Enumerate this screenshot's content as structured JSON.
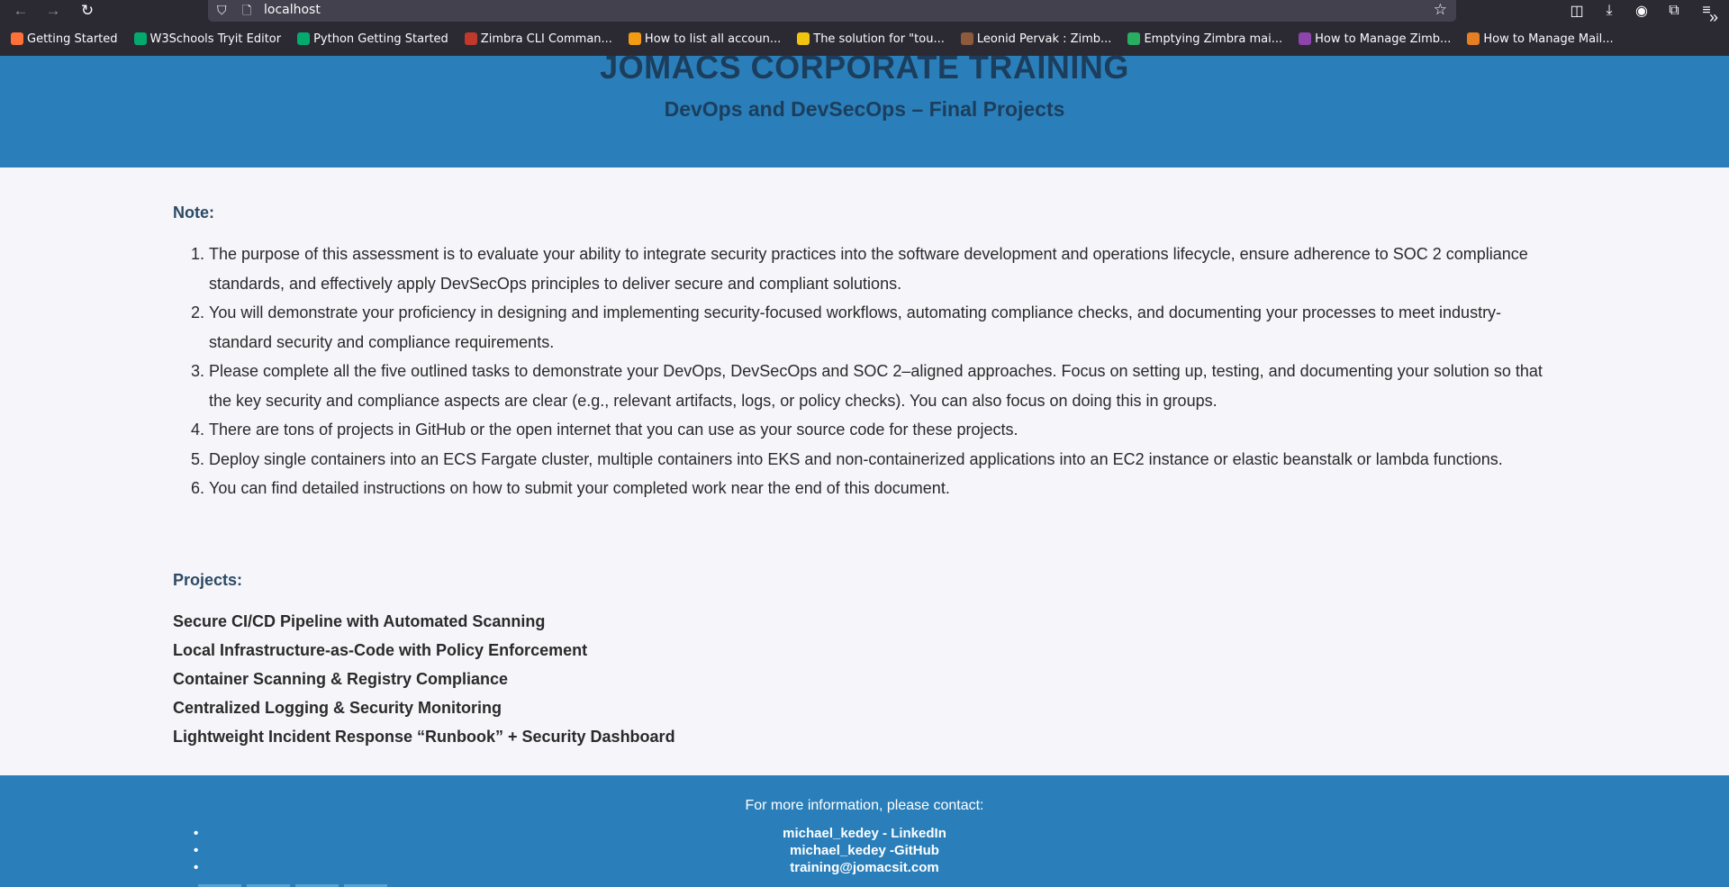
{
  "browser": {
    "url": "localhost",
    "bookmarks": [
      {
        "label": "Getting Started",
        "icon": "firefox-icon",
        "color": "#ff7139"
      },
      {
        "label": "W3Schools Tryit Editor",
        "icon": "w3schools-icon",
        "color": "#04aa6d"
      },
      {
        "label": "Python Getting Started",
        "icon": "w3schools-icon",
        "color": "#04aa6d"
      },
      {
        "label": "Zimbra CLI Comman...",
        "icon": "zimbra-icon",
        "color": "#c0392b"
      },
      {
        "label": "How to list all accoun...",
        "icon": "z-icon",
        "color": "#f39c12"
      },
      {
        "label": "The solution for \"tou...",
        "icon": "linux-icon",
        "color": "#f1c40f"
      },
      {
        "label": "Leonid Pervak : Zimb...",
        "icon": "avatar-icon",
        "color": "#8e5a3c"
      },
      {
        "label": "Emptying Zimbra mai...",
        "icon": "site-icon",
        "color": "#27ae60"
      },
      {
        "label": "How to Manage Zimb...",
        "icon": "site-icon",
        "color": "#8e44ad"
      },
      {
        "label": "How to Manage Mail...",
        "icon": "site-icon",
        "color": "#e67e22"
      }
    ]
  },
  "header": {
    "title": "JOMACS CORPORATE TRAINING",
    "subtitle": "DevOps and DevSecOps – Final Projects"
  },
  "note": {
    "heading": "Note:",
    "items": [
      "The purpose of this assessment is to evaluate your ability to integrate security practices into the software development and operations lifecycle, ensure adherence to SOC 2 compliance standards, and effectively apply DevSecOps principles to deliver secure and compliant solutions.",
      "You will demonstrate your proficiency in designing and implementing security-focused workflows, automating compliance checks, and documenting your processes to meet industry-standard security and compliance requirements.",
      "Please complete all the five outlined tasks to demonstrate your DevOps, DevSecOps and SOC 2–aligned approaches. Focus on setting up, testing, and documenting your solution so that the key security and compliance aspects are clear (e.g., relevant artifacts, logs, or policy checks). You can also focus on doing this in groups.",
      "There are tons of projects in GitHub or the open internet that you can use as your source code for these projects.",
      "Deploy single containers into an ECS Fargate cluster, multiple containers into EKS and non-containerized applications into an EC2 instance or elastic beanstalk or lambda functions.",
      "You can find detailed instructions on how to submit your completed work near the end of this document."
    ]
  },
  "projects": {
    "heading": "Projects:",
    "items": [
      "Secure CI/CD Pipeline with Automated Scanning",
      "Local Infrastructure-as-Code with Policy Enforcement",
      "Container Scanning & Registry Compliance",
      "Centralized Logging & Security Monitoring",
      "Lightweight Incident Response “Runbook” + Security Dashboard"
    ]
  },
  "footer": {
    "note": "For more information, please contact:",
    "contacts": [
      "michael_kedey - LinkedIn",
      "michael_kedey -GitHub",
      "training@jomacsit.com"
    ]
  },
  "colors": {
    "header_bg": "#2a7fba",
    "heading_text": "#1c3e5c",
    "page_bg": "#f5f5fa"
  }
}
